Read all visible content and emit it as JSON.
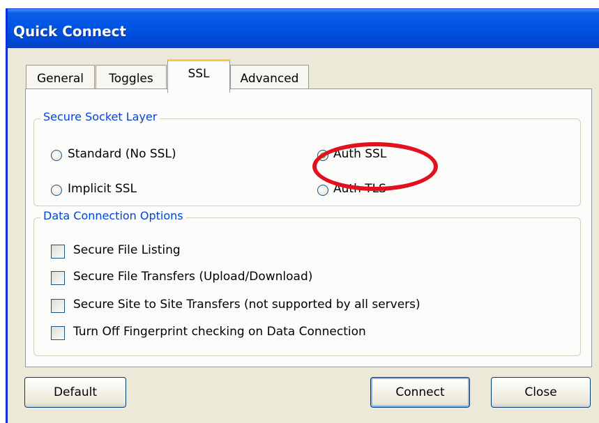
{
  "window": {
    "title": "Quick Connect"
  },
  "tabs": [
    {
      "label": "General"
    },
    {
      "label": "Toggles"
    },
    {
      "label": "SSL",
      "selected": true
    },
    {
      "label": "Advanced"
    }
  ],
  "ssl_group": {
    "legend": "Secure Socket Layer",
    "options": [
      {
        "label": "Standard (No SSL)",
        "selected": false
      },
      {
        "label": "Auth SSL",
        "selected": true
      },
      {
        "label": "Implicit SSL",
        "selected": false
      },
      {
        "label": "Auth TLS",
        "selected": false
      }
    ]
  },
  "data_group": {
    "legend": "Data Connection Options",
    "options": [
      {
        "label": "Secure File Listing",
        "checked": false
      },
      {
        "label": "Secure File Transfers (Upload/Download)",
        "checked": false
      },
      {
        "label": "Secure Site to Site Transfers (not supported by all servers)",
        "checked": false
      },
      {
        "label": "Turn Off Fingerprint checking on Data Connection",
        "checked": false
      }
    ]
  },
  "buttons": {
    "default": "Default",
    "connect": "Connect",
    "close": "Close"
  },
  "colors": {
    "titlebar": "#0055e5",
    "accent_legend": "#0046d5",
    "highlight": "#e3101e",
    "tab_selected_top": "#ffc73c"
  }
}
